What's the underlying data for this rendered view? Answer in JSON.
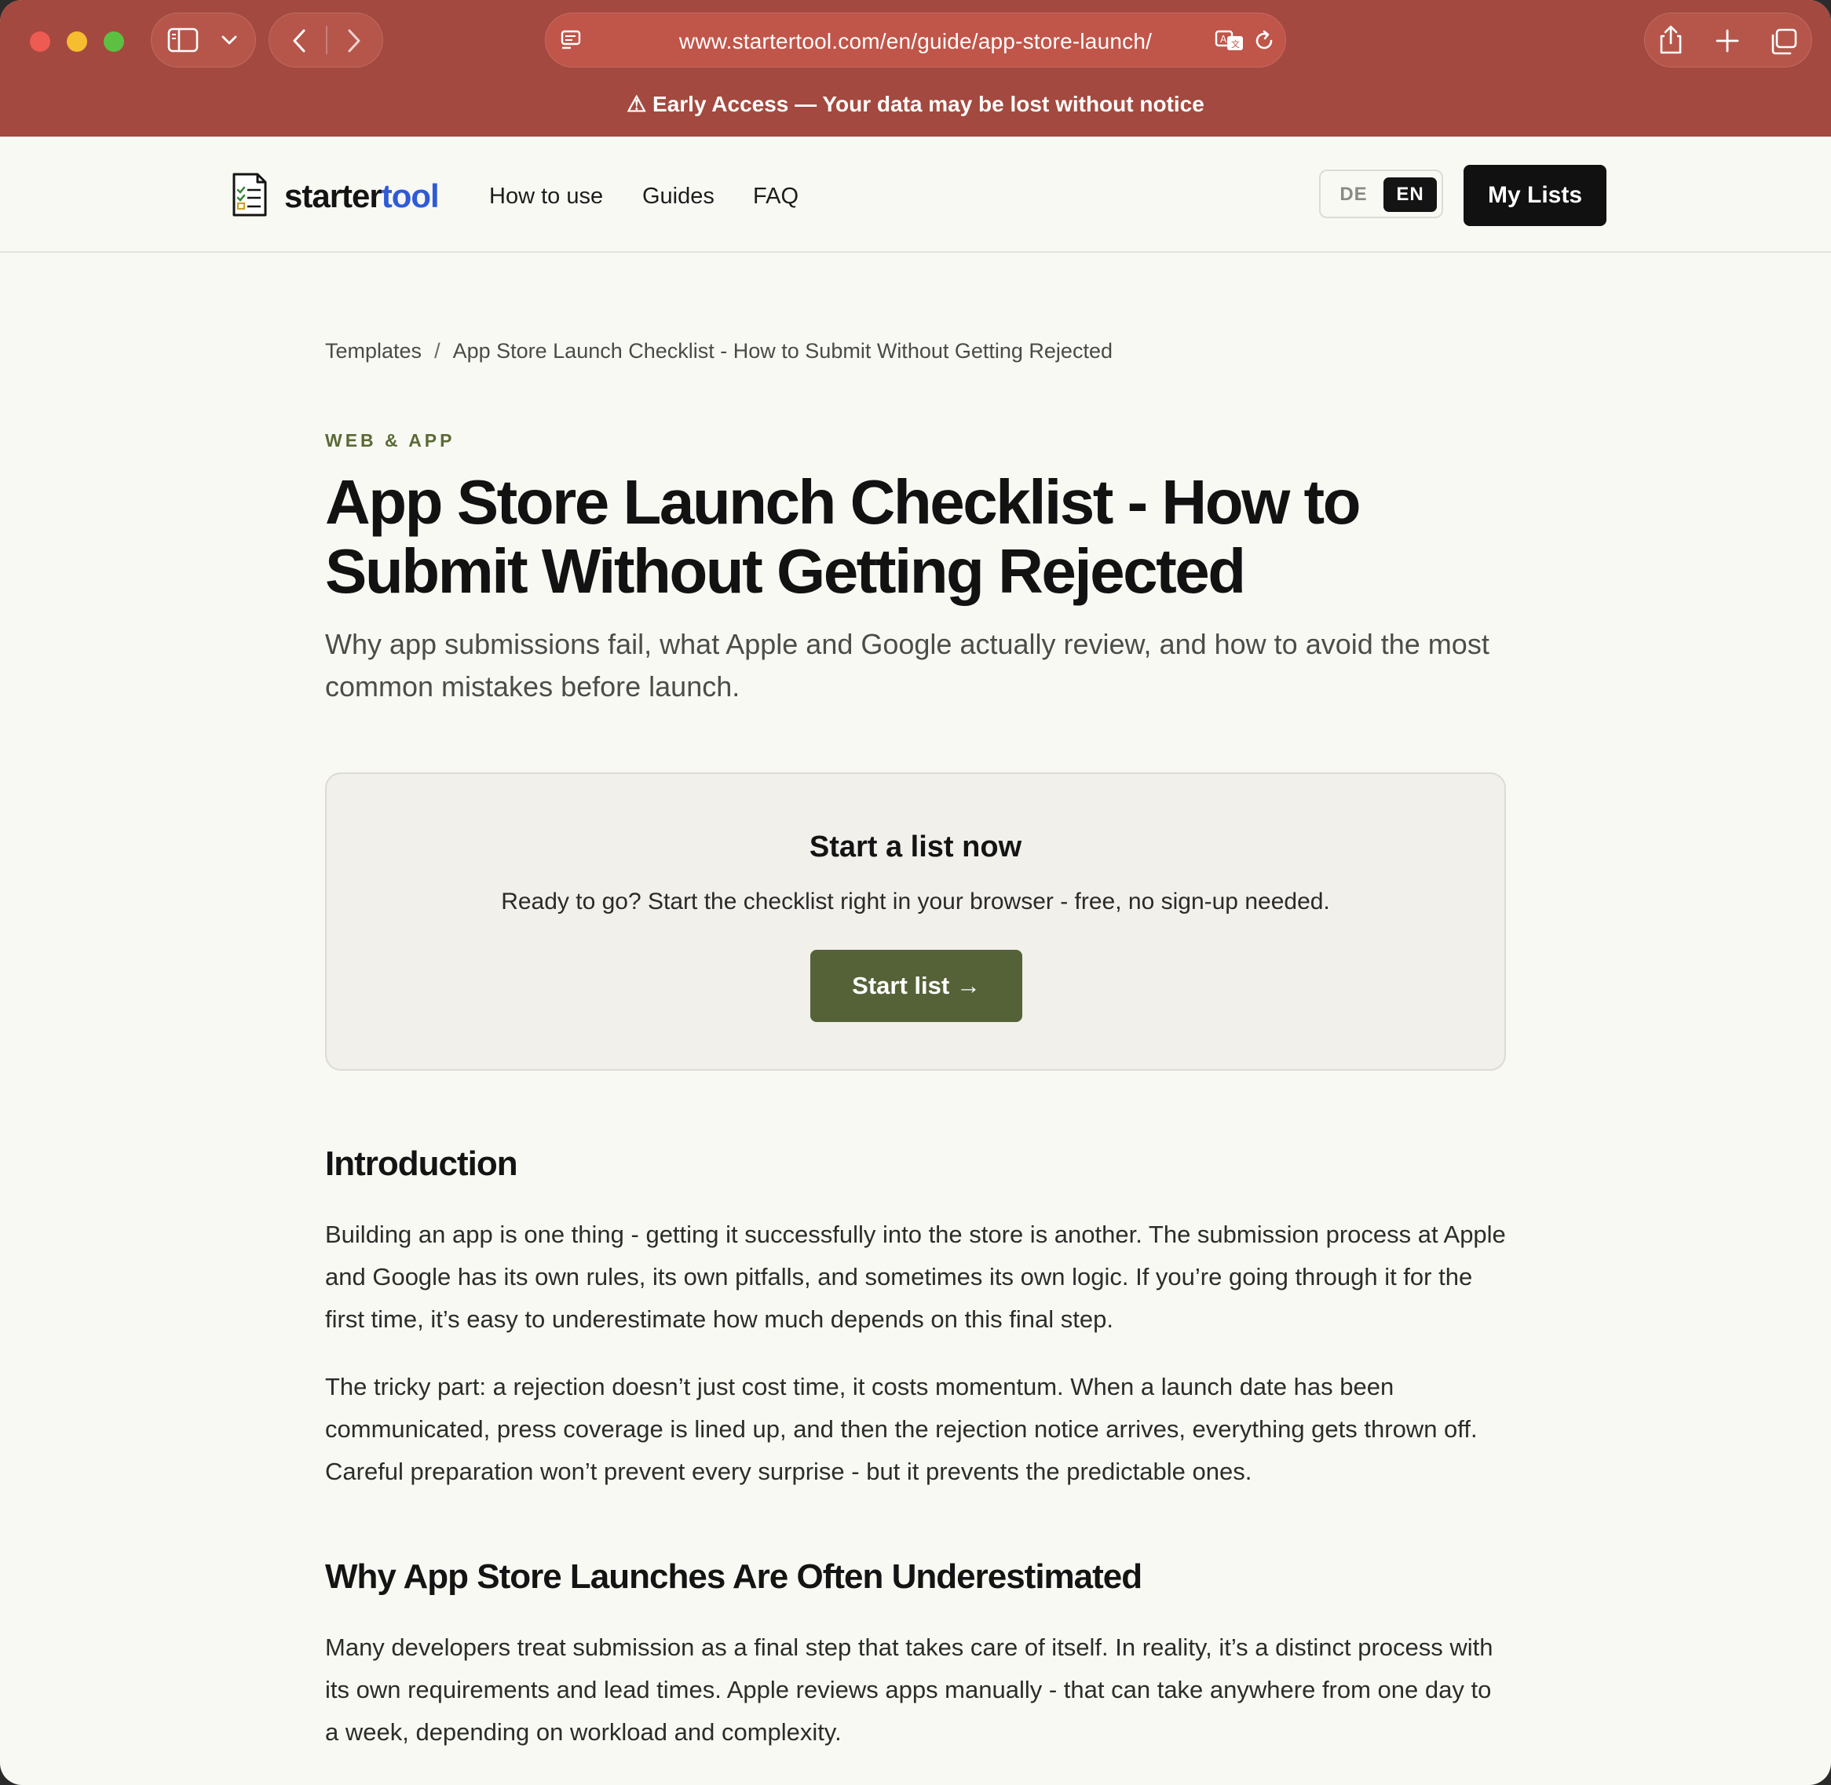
{
  "browser": {
    "url": "www.startertool.com/en/guide/app-store-launch/",
    "banner": "⚠ Early Access — Your data may be lost without notice",
    "colors": {
      "chrome": "#a3493f",
      "url_field": "#c0554a"
    }
  },
  "header": {
    "logo_part1": "starter",
    "logo_part2": "tool",
    "nav": [
      "How to use",
      "Guides",
      "FAQ"
    ],
    "lang_de": "DE",
    "lang_en": "EN",
    "my_lists": "My Lists"
  },
  "breadcrumb": {
    "root": "Templates",
    "separator": "/",
    "current": "App Store Launch Checklist - How to Submit Without Getting Rejected"
  },
  "article": {
    "category": "WEB & APP",
    "title": "App Store Launch Checklist - How to Submit Without Getting Rejected",
    "subtitle": "Why app submissions fail, what Apple and Google actually review, and how to avoid the most common mistakes before launch."
  },
  "cta": {
    "title": "Start a list now",
    "text": "Ready to go? Start the checklist right in your browser - free, no sign-up needed.",
    "button": "Start list →",
    "button_color": "#556238"
  },
  "sections": [
    {
      "heading": "Introduction",
      "paragraphs": [
        "Building an app is one thing - getting it successfully into the store is another. The submission process at Apple and Google has its own rules, its own pitfalls, and sometimes its own logic. If you’re going through it for the first time, it’s easy to underestimate how much depends on this final step.",
        "The tricky part: a rejection doesn’t just cost time, it costs momentum. When a launch date has been communicated, press coverage is lined up, and then the rejection notice arrives, everything gets thrown off. Careful preparation won’t prevent every surprise - but it prevents the predictable ones."
      ]
    },
    {
      "heading": "Why App Store Launches Are Often Underestimated",
      "paragraphs": [
        "Many developers treat submission as a final step that takes care of itself. In reality, it’s a distinct process with its own requirements and lead times. Apple reviews apps manually - that can take anywhere from one day to a week, depending on workload and complexity."
      ]
    }
  ]
}
